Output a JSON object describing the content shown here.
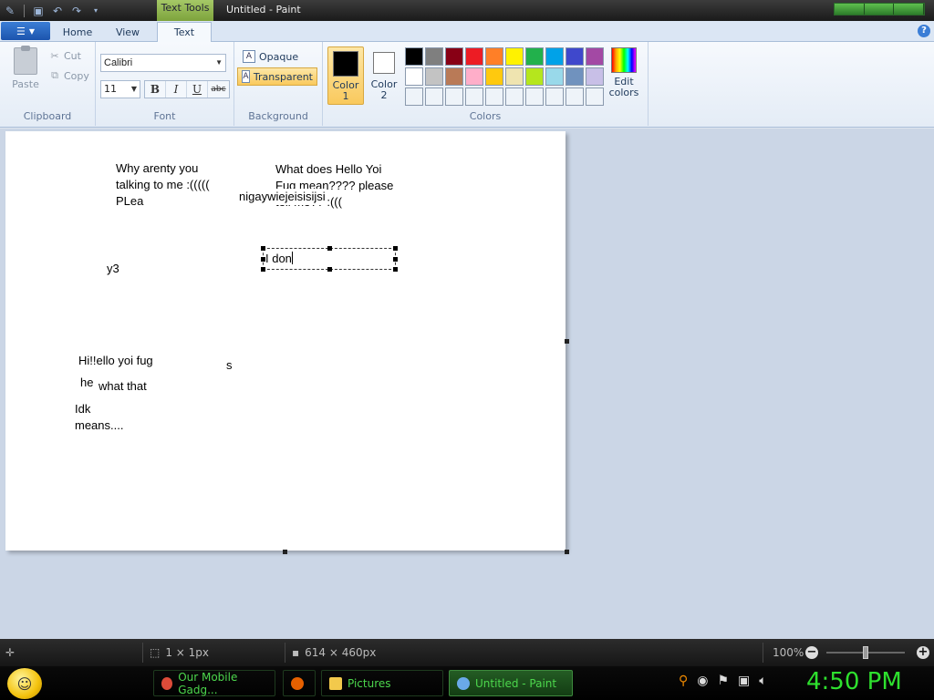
{
  "window": {
    "title": "Untitled - Paint",
    "context_tab": "Text Tools"
  },
  "tabs": [
    {
      "label": "Home"
    },
    {
      "label": "View"
    },
    {
      "label": "Text"
    }
  ],
  "ribbon": {
    "clipboard": {
      "label": "Clipboard",
      "paste": "Paste",
      "cut": "Cut",
      "copy": "Copy"
    },
    "font": {
      "label": "Font",
      "family": "Calibri",
      "size": "11",
      "bold": "B",
      "italic": "I",
      "underline": "U",
      "strike": "abc"
    },
    "background": {
      "label": "Background",
      "opaque": "Opaque",
      "transparent": "Transparent"
    },
    "colors": {
      "label": "Colors",
      "color1_label_a": "Color",
      "color1_label_b": "1",
      "color2_label_a": "Color",
      "color2_label_b": "2",
      "color1": "#000000",
      "color2": "#ffffff",
      "edit_a": "Edit",
      "edit_b": "colors",
      "palette": [
        "#000000",
        "#7f7f7f",
        "#880015",
        "#ed1c24",
        "#ff7f27",
        "#fff200",
        "#22b14c",
        "#00a2e8",
        "#3f48cc",
        "#a349a4",
        "#ffffff",
        "#c3c3c3",
        "#b97a57",
        "#ffaec9",
        "#ffc90e",
        "#efe4b0",
        "#b5e61d",
        "#99d9ea",
        "#7092be",
        "#c8bfe7",
        "#eef3f9",
        "#eef3f9",
        "#eef3f9",
        "#eef3f9",
        "#eef3f9",
        "#eef3f9",
        "#eef3f9",
        "#eef3f9",
        "#eef3f9",
        "#eef3f9"
      ]
    }
  },
  "canvas": {
    "texts": [
      {
        "text": "Why arenty you\ntalking to me :(((((\nPLea"
      },
      {
        "text": "What does Hello Yoi\nFug mean???? please\ntell me?? :((("
      },
      {
        "text": "nigaywiejeisisijsi"
      },
      {
        "text": "y3"
      },
      {
        "text": "Hi!!ello yoi fug"
      },
      {
        "text": "s"
      },
      {
        "text": "he"
      },
      {
        "text": "what that"
      },
      {
        "text": "Idk\nmeans...."
      }
    ],
    "active_textbox_value": "I don"
  },
  "statusbar": {
    "selection_size": "1 × 1px",
    "canvas_size": "614 × 460px",
    "zoom": "100%"
  },
  "taskbar": {
    "items": [
      {
        "label": "Our Mobile Gadg...",
        "icon": "chrome-icon",
        "color": "#dd4b39"
      },
      {
        "label": "",
        "icon": "firefox-icon",
        "color": "#e66000"
      },
      {
        "label": "Pictures",
        "icon": "folder-icon",
        "color": "#f2c94c"
      },
      {
        "label": "Untitled - Paint",
        "icon": "paint-icon",
        "color": "#6aa9e8"
      }
    ],
    "clock": "4:50 PM"
  }
}
